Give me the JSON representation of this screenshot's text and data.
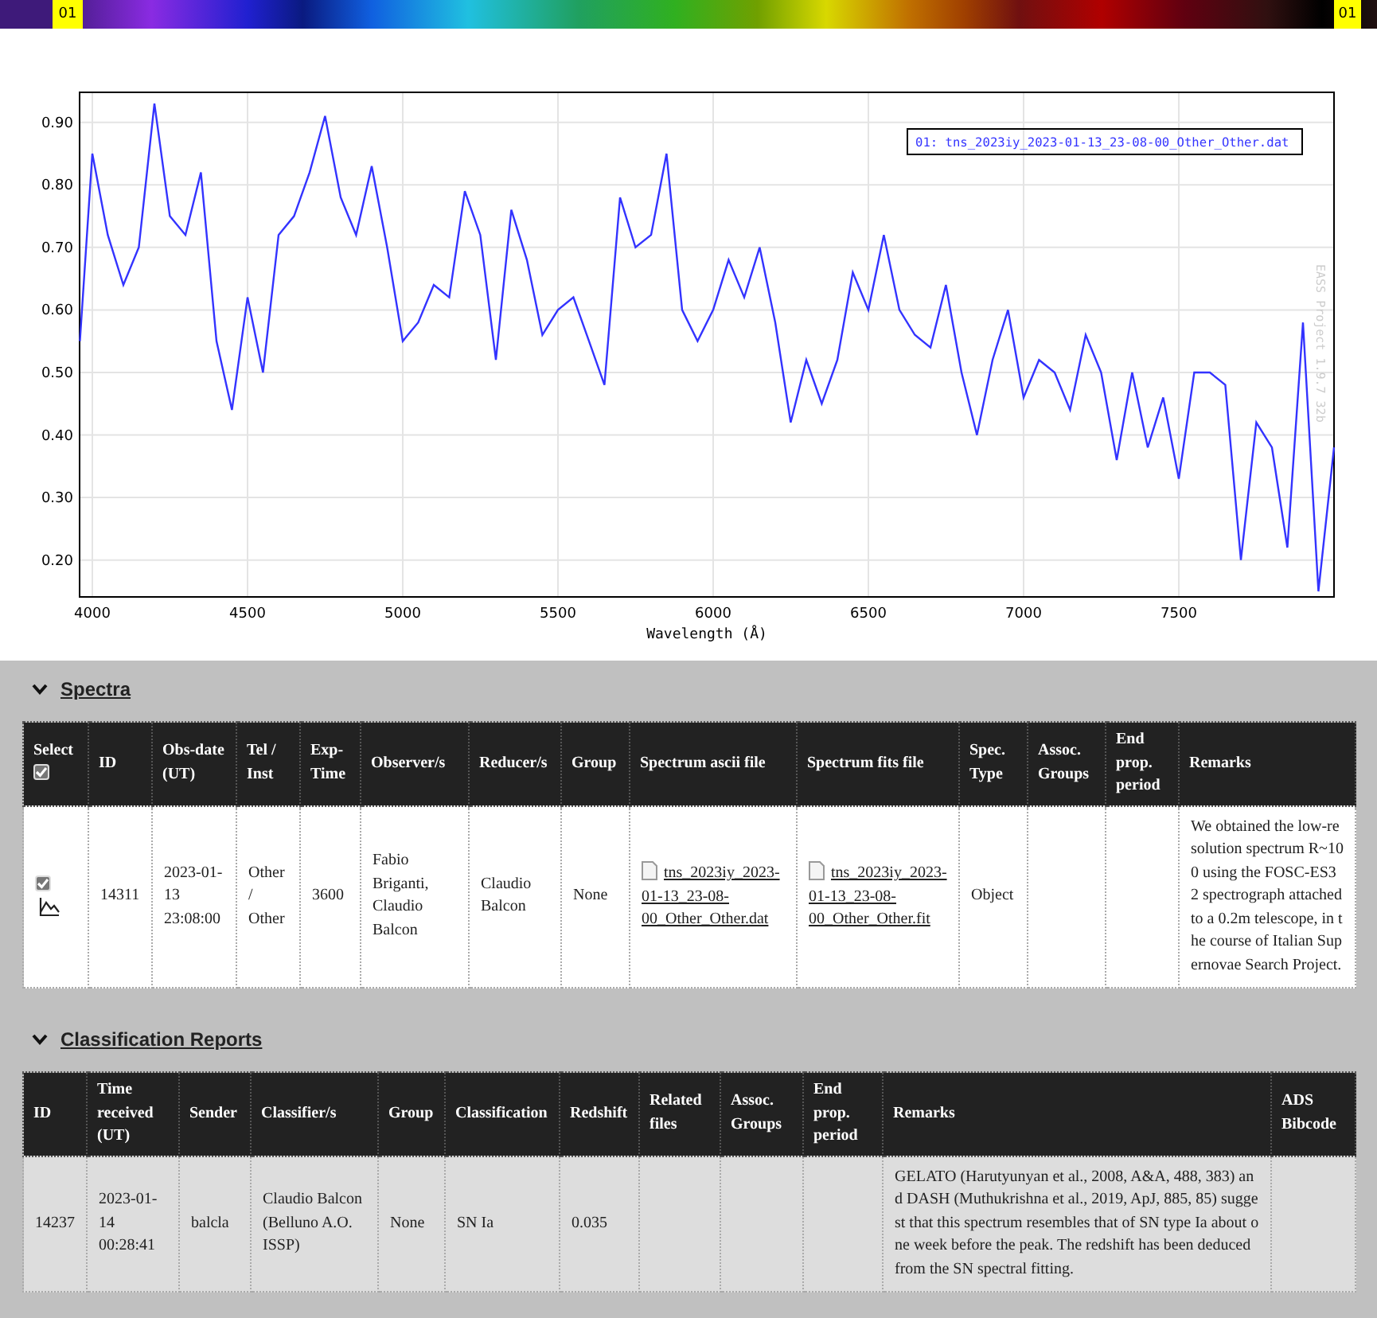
{
  "color_bar": {
    "left_label": "01",
    "right_label": "01"
  },
  "plot": {
    "credit": "EASS Project 1.9.7 32b",
    "chart_data": {
      "type": "line",
      "grid": true,
      "xlabel": "Wavelength (Å)",
      "xlim": [
        3959,
        8000
      ],
      "ylim": [
        0.141,
        0.948
      ],
      "xticks": [
        4000,
        4500,
        5000,
        5500,
        6000,
        6500,
        7000,
        7500
      ],
      "yticks": [
        {
          "value": 0.9,
          "label": "0.90"
        },
        {
          "value": 0.8,
          "label": "0.80"
        },
        {
          "value": 0.7,
          "label": "0.70"
        },
        {
          "value": 0.6,
          "label": "0.60"
        },
        {
          "value": 0.5,
          "label": "0.50"
        },
        {
          "value": 0.4,
          "label": "0.40"
        },
        {
          "value": 0.3,
          "label": "0.30"
        },
        {
          "value": 0.2,
          "label": "0.20"
        }
      ],
      "x": [
        3960,
        4000,
        4050,
        4100,
        4150,
        4200,
        4250,
        4300,
        4350,
        4400,
        4450,
        4500,
        4550,
        4600,
        4650,
        4700,
        4750,
        4800,
        4850,
        4900,
        4950,
        5000,
        5050,
        5100,
        5150,
        5200,
        5250,
        5300,
        5350,
        5400,
        5450,
        5500,
        5550,
        5600,
        5650,
        5700,
        5750,
        5800,
        5850,
        5900,
        5950,
        6000,
        6050,
        6100,
        6150,
        6200,
        6250,
        6300,
        6350,
        6400,
        6450,
        6500,
        6550,
        6600,
        6650,
        6700,
        6750,
        6800,
        6850,
        6900,
        6950,
        7000,
        7050,
        7100,
        7150,
        7200,
        7250,
        7300,
        7350,
        7400,
        7450,
        7500,
        7550,
        7600,
        7650,
        7700,
        7750,
        7800,
        7850,
        7900,
        7950,
        8000
      ],
      "series": [
        {
          "name": "01: tns_2023iy_2023-01-13_23-08-00_Other_Other.dat",
          "color": "#3333ff",
          "values": [
            0.55,
            0.85,
            0.72,
            0.64,
            0.7,
            0.93,
            0.75,
            0.72,
            0.82,
            0.55,
            0.44,
            0.62,
            0.5,
            0.72,
            0.75,
            0.82,
            0.91,
            0.78,
            0.72,
            0.83,
            0.7,
            0.55,
            0.58,
            0.64,
            0.62,
            0.79,
            0.72,
            0.52,
            0.76,
            0.68,
            0.56,
            0.6,
            0.62,
            0.55,
            0.48,
            0.78,
            0.7,
            0.72,
            0.85,
            0.6,
            0.55,
            0.6,
            0.68,
            0.62,
            0.7,
            0.58,
            0.42,
            0.52,
            0.45,
            0.52,
            0.66,
            0.6,
            0.72,
            0.6,
            0.56,
            0.54,
            0.64,
            0.5,
            0.4,
            0.52,
            0.6,
            0.46,
            0.52,
            0.5,
            0.44,
            0.56,
            0.5,
            0.36,
            0.5,
            0.38,
            0.46,
            0.33,
            0.5,
            0.5,
            0.48,
            0.2,
            0.42,
            0.38,
            0.22,
            0.58,
            0.15,
            0.38
          ]
        }
      ]
    }
  },
  "sections": [
    {
      "title": "Spectra",
      "expanded": true,
      "columns": [
        {
          "label": "Select",
          "kind": "select",
          "checked": true
        },
        {
          "label": "ID"
        },
        {
          "label": "Obs-date (UT)"
        },
        {
          "label": "Tel / Inst"
        },
        {
          "label": "Exp-Time"
        },
        {
          "label": "Observer/s"
        },
        {
          "label": "Reducer/s"
        },
        {
          "label": "Group"
        },
        {
          "label": "Spectrum ascii file"
        },
        {
          "label": "Spectrum fits file"
        },
        {
          "label": "Spec. Type"
        },
        {
          "label": "Assoc. Groups"
        },
        {
          "label": "End prop. period"
        },
        {
          "label": "Remarks"
        }
      ],
      "rows": [
        {
          "cells": [
            {
              "kind": "select",
              "checked": true
            },
            {
              "kind": "text",
              "text": "14311"
            },
            {
              "kind": "text",
              "text": "2023-01-13 23:08:00"
            },
            {
              "kind": "text",
              "text": "Other / Other"
            },
            {
              "kind": "text",
              "text": "3600"
            },
            {
              "kind": "text",
              "text": "Fabio Briganti, Claudio Balcon"
            },
            {
              "kind": "text",
              "text": "Claudio Balcon"
            },
            {
              "kind": "text",
              "text": "None"
            },
            {
              "kind": "file",
              "text": "tns_2023iy_2023-01-13_23-08-00_Other_Other.dat"
            },
            {
              "kind": "file",
              "text": "tns_2023iy_2023-01-13_23-08-00_Other_Other.fit"
            },
            {
              "kind": "text",
              "text": "Object"
            },
            {
              "kind": "text"
            },
            {
              "kind": "text"
            },
            {
              "kind": "remark",
              "text": "We obtained the low-resolution spectrum R~100 using the FOSC-ES32 spectrograph attached to a 0.2m telescope, in the course of Italian Supernovae Search Project."
            }
          ]
        }
      ]
    },
    {
      "title": "Classification Reports",
      "expanded": true,
      "columns": [
        {
          "label": "ID"
        },
        {
          "label": "Time received (UT)"
        },
        {
          "label": "Sender"
        },
        {
          "label": "Classifier/s"
        },
        {
          "label": "Group"
        },
        {
          "label": "Classification"
        },
        {
          "label": "Redshift"
        },
        {
          "label": "Related files"
        },
        {
          "label": "Assoc. Groups"
        },
        {
          "label": "End prop. period"
        },
        {
          "label": "Remarks"
        },
        {
          "label": "ADS Bibcode"
        }
      ],
      "rows": [
        {
          "cells": [
            {
              "kind": "text",
              "text": "14237"
            },
            {
              "kind": "text",
              "text": "2023-01-14 00:28:41"
            },
            {
              "kind": "text",
              "text": "balcla"
            },
            {
              "kind": "text",
              "text": "Claudio Balcon (Belluno A.O. ISSP)"
            },
            {
              "kind": "text",
              "text": "None"
            },
            {
              "kind": "text",
              "text": "SN Ia"
            },
            {
              "kind": "text",
              "text": "0.035"
            },
            {
              "kind": "text"
            },
            {
              "kind": "text"
            },
            {
              "kind": "text"
            },
            {
              "kind": "remark",
              "text": "GELATO (Harutyunyan et al., 2008, A&A, 488, 383) and DASH (Muthukrishna et al., 2019, ApJ, 885, 85) suggest that this spectrum resembles that of SN type Ia about one week before the peak. The redshift has been deduced from the SN spectral fitting."
            },
            {
              "kind": "text"
            }
          ]
        }
      ]
    }
  ]
}
